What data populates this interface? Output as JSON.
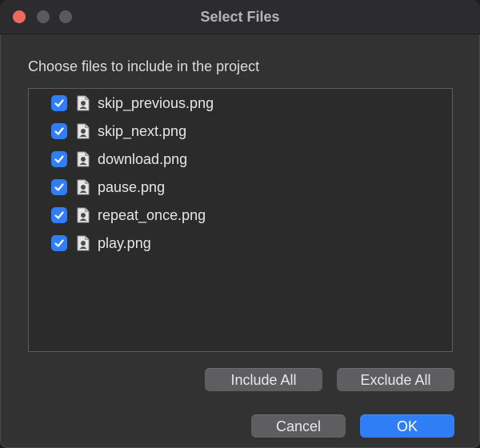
{
  "window": {
    "title": "Select Files"
  },
  "dialog": {
    "prompt": "Choose files to include in the project",
    "files": [
      {
        "name": "skip_previous.png",
        "checked": true
      },
      {
        "name": "skip_next.png",
        "checked": true
      },
      {
        "name": "download.png",
        "checked": true
      },
      {
        "name": "pause.png",
        "checked": true
      },
      {
        "name": "repeat_once.png",
        "checked": true
      },
      {
        "name": "play.png",
        "checked": true
      }
    ],
    "include_all_label": "Include All",
    "exclude_all_label": "Exclude All",
    "cancel_label": "Cancel",
    "ok_label": "OK"
  },
  "colors": {
    "accent": "#2f7ef6",
    "close_button": "#ed6a5e",
    "inactive_button": "#5a5a5d"
  },
  "icons": {
    "checkbox": "checkmark-icon",
    "file": "image-file-icon"
  }
}
